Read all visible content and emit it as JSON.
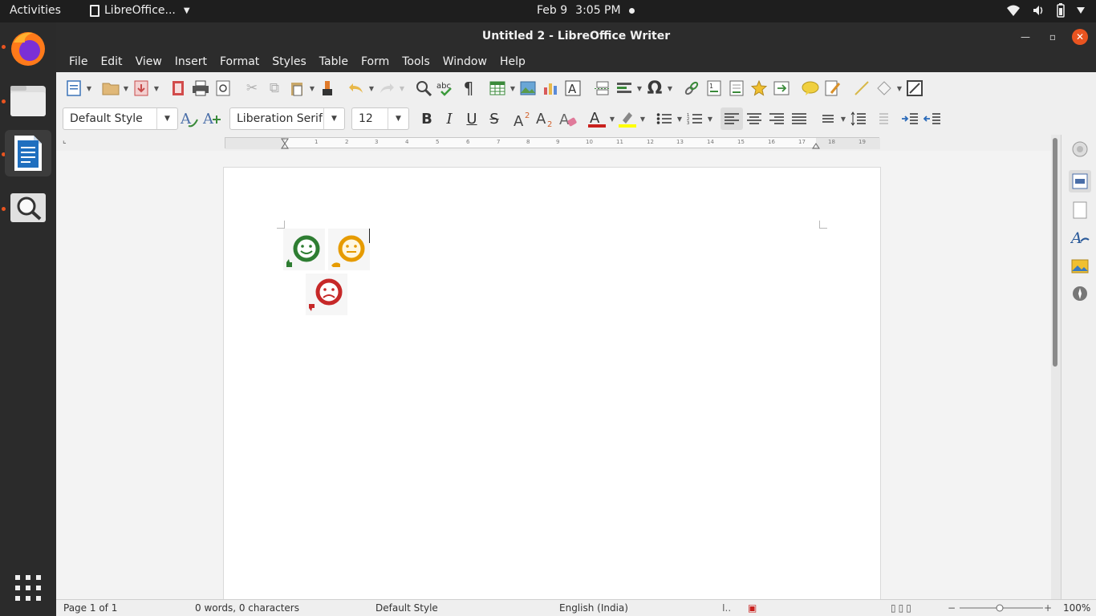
{
  "topbar": {
    "activities": "Activities",
    "app_menu": "LibreOffice...",
    "date": "Feb 9",
    "time": "3:05 PM"
  },
  "dock": {
    "items": [
      "firefox-icon",
      "files-icon",
      "writer-icon",
      "search-icon",
      "show-apps-icon"
    ]
  },
  "window": {
    "title": "Untitled 2 - LibreOffice Writer"
  },
  "menubar": {
    "items": [
      "File",
      "Edit",
      "View",
      "Insert",
      "Format",
      "Styles",
      "Table",
      "Form",
      "Tools",
      "Window",
      "Help"
    ]
  },
  "formatting": {
    "paragraph_style": "Default Style",
    "font_name": "Liberation Serif",
    "font_size": "12",
    "bold": "B",
    "italic": "I",
    "underline": "U",
    "strikethrough": "S"
  },
  "ruler": {
    "ticks": [
      "1",
      "2",
      "3",
      "4",
      "5",
      "6",
      "7",
      "8",
      "9",
      "10",
      "11",
      "12",
      "13",
      "14",
      "15",
      "16",
      "17",
      "18",
      "19"
    ]
  },
  "document": {
    "images": [
      {
        "name": "happy-face",
        "color": "#2e7d32"
      },
      {
        "name": "neutral-face",
        "color": "#e69b00"
      },
      {
        "name": "sad-face",
        "color": "#c62828"
      }
    ]
  },
  "statusbar": {
    "page": "Page 1 of 1",
    "words": "0 words, 0 characters",
    "page_style": "Default Style",
    "language": "English (India)",
    "zoom": "100%"
  },
  "colors": {
    "accent": "#e95420",
    "font_color": "#c9211e",
    "highlight": "#ffff00"
  }
}
